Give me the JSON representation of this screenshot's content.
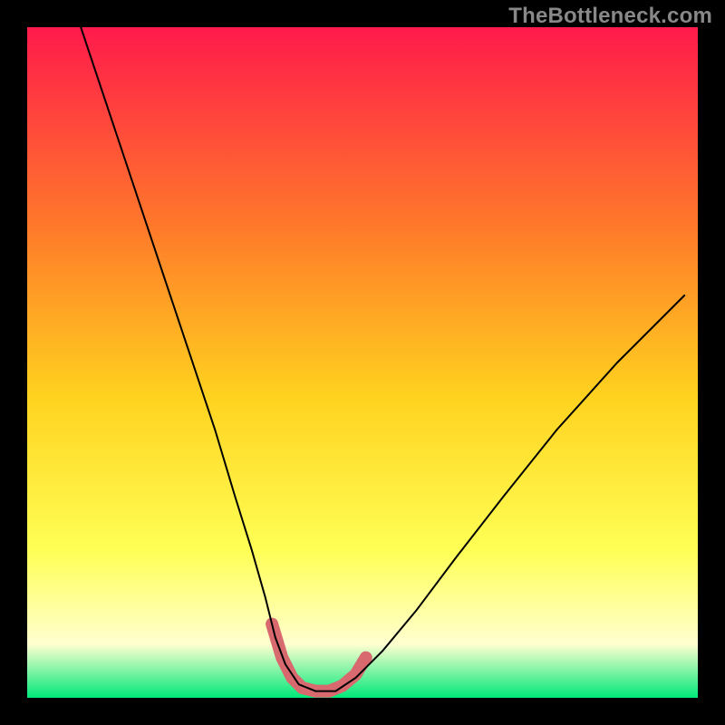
{
  "watermark": "TheBottleneck.com",
  "colors": {
    "gradient_top": "#ff1a4b",
    "gradient_mid1": "#ff7a2a",
    "gradient_mid2": "#ffd21f",
    "gradient_mid3": "#ffff55",
    "gradient_bottom_pale": "#ffffd0",
    "gradient_green": "#00e87a",
    "curve": "#000000",
    "highlight": "#d86a6f",
    "frame": "#000000"
  },
  "chart_data": {
    "type": "line",
    "title": "",
    "xlabel": "",
    "ylabel": "",
    "xlim": [
      0,
      100
    ],
    "ylim": [
      0,
      100
    ],
    "series": [
      {
        "name": "bottleneck-curve",
        "x": [
          8,
          12,
          16,
          20,
          24,
          28,
          31,
          33.5,
          35.5,
          37,
          38.5,
          40.5,
          43,
          46,
          49,
          53,
          58,
          64,
          71,
          79,
          88,
          98
        ],
        "y": [
          100,
          88,
          76,
          64,
          52,
          40,
          30,
          22,
          15,
          9,
          5,
          2,
          1,
          1,
          3,
          7,
          13,
          21,
          30,
          40,
          50,
          60
        ]
      },
      {
        "name": "highlight-segment",
        "x": [
          36.5,
          38,
          39.5,
          41,
          43,
          45,
          47,
          49,
          50.5
        ],
        "y": [
          11,
          6,
          3,
          1.5,
          1,
          1,
          1.8,
          3.5,
          6
        ]
      }
    ],
    "grid": false,
    "legend": false
  }
}
